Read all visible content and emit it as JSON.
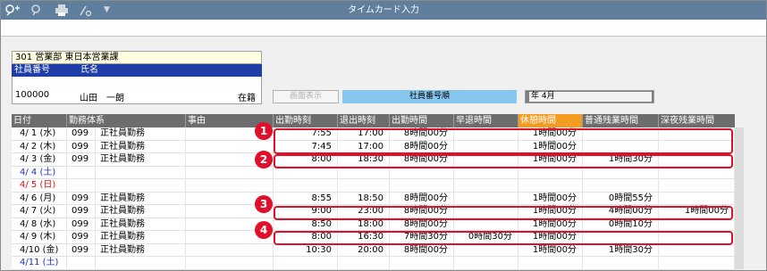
{
  "window": {
    "title": "タイムカード入力",
    "tools": [
      "search-add-icon",
      "search-icon",
      "print-icon",
      "settings-icon",
      "dropdown-icon"
    ]
  },
  "employee": {
    "department": "301 営業部 東日本営業課",
    "id_label": "社員番号",
    "name_label": "氏名",
    "id": "100000",
    "name": "山田　一朗",
    "status": "在籍"
  },
  "controls": {
    "display_button": "画面表示",
    "sort_label": "社員番号順",
    "month": "年 4月"
  },
  "grid": {
    "columns": [
      "日付",
      "勤務体系",
      "事由",
      "出勤時刻",
      "退出時刻",
      "出勤時間",
      "早退時間",
      "休憩時間",
      "普通残業時間",
      "深夜残業時間"
    ],
    "rows": [
      {
        "date": "4/ 1 (水)",
        "dc": "",
        "code": "099",
        "type": "正社員勤務",
        "reason": "",
        "in": "7:55",
        "out": "17:00",
        "work": "8時間00分",
        "early": "",
        "break": "1時間00分",
        "ot": "",
        "night": ""
      },
      {
        "date": "4/ 2 (木)",
        "dc": "",
        "code": "099",
        "type": "正社員勤務",
        "reason": "",
        "in": "7:45",
        "out": "17:00",
        "work": "8時間00分",
        "early": "",
        "break": "1時間00分",
        "ot": "",
        "night": ""
      },
      {
        "date": "4/ 3 (金)",
        "dc": "",
        "code": "099",
        "type": "正社員勤務",
        "reason": "",
        "in": "8:00",
        "out": "18:30",
        "work": "8時間00分",
        "early": "",
        "break": "1時間00分",
        "ot": "1時間30分",
        "night": ""
      },
      {
        "date": "4/ 4 (土)",
        "dc": "blue",
        "code": "",
        "type": "",
        "reason": "",
        "in": "",
        "out": "",
        "work": "",
        "early": "",
        "break": "",
        "ot": "",
        "night": ""
      },
      {
        "date": "4/ 5 (日)",
        "dc": "red",
        "code": "",
        "type": "",
        "reason": "",
        "in": "",
        "out": "",
        "work": "",
        "early": "",
        "break": "",
        "ot": "",
        "night": ""
      },
      {
        "date": "4/ 6 (月)",
        "dc": "",
        "code": "099",
        "type": "正社員勤務",
        "reason": "",
        "in": "8:55",
        "out": "18:50",
        "work": "8時間00分",
        "early": "",
        "break": "1時間00分",
        "ot": "0時間55分",
        "night": ""
      },
      {
        "date": "4/ 7 (火)",
        "dc": "",
        "code": "099",
        "type": "正社員勤務",
        "reason": "",
        "in": "9:00",
        "out": "23:00",
        "work": "8時間00分",
        "early": "",
        "break": "1時間00分",
        "ot": "4時間00分",
        "night": "1時間00分"
      },
      {
        "date": "4/ 8 (水)",
        "dc": "",
        "code": "099",
        "type": "正社員勤務",
        "reason": "",
        "in": "8:50",
        "out": "18:00",
        "work": "8時間00分",
        "early": "",
        "break": "1時間00分",
        "ot": "0時間10分",
        "night": ""
      },
      {
        "date": "4/ 9 (木)",
        "dc": "",
        "code": "099",
        "type": "正社員勤務",
        "reason": "",
        "in": "8:00",
        "out": "16:30",
        "work": "7時間30分",
        "early": "0時間30分",
        "break": "1時間00分",
        "ot": "",
        "night": ""
      },
      {
        "date": "4/10 (金)",
        "dc": "",
        "code": "099",
        "type": "正社員勤務",
        "reason": "",
        "in": "10:30",
        "out": "20:00",
        "work": "8時間00分",
        "early": "",
        "break": "1時間00分",
        "ot": "1時間30分",
        "night": ""
      },
      {
        "date": "4/11 (土)",
        "dc": "blue",
        "code": "",
        "type": "",
        "reason": "",
        "in": "",
        "out": "",
        "work": "",
        "early": "",
        "break": "",
        "ot": "",
        "night": ""
      }
    ]
  },
  "callouts": [
    "1",
    "2",
    "3",
    "4"
  ],
  "colors": {
    "highlight": "#e0102a",
    "header": "#6d6d6d",
    "break_header": "#f49b22",
    "title_bar": "#5f7f9c"
  }
}
